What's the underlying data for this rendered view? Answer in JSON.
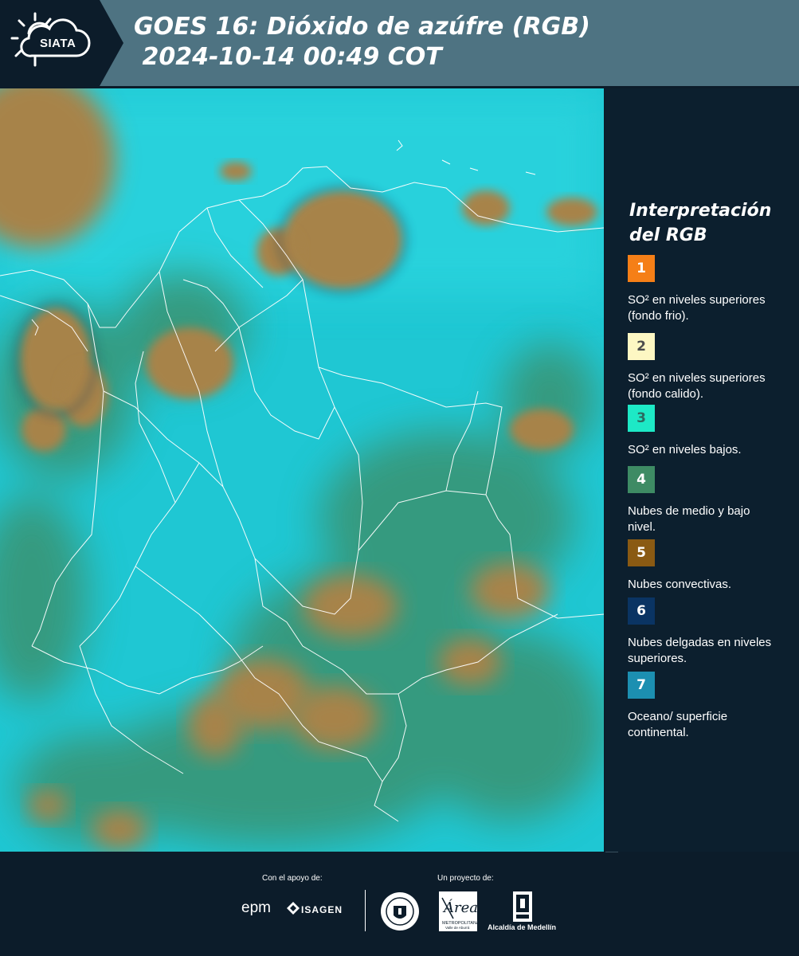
{
  "header": {
    "logo_text": "SIATA",
    "title_line1": "GOES 16: Dióxido de azúfre (RGB)",
    "title_line2": " 2024-10-14 00:49 COT",
    "background_color": "#4e7382"
  },
  "legend": {
    "title_line1": "Interpretación",
    "title_line2": "del RGB",
    "items": [
      {
        "number": "1",
        "color": "#f57f17",
        "text_color": "#ffffff",
        "description": "SO² en niveles superiores (fondo frio)."
      },
      {
        "number": "2",
        "color": "#fdf7c3",
        "text_color": "#4d4d4d",
        "description": "SO² en niveles superiores (fondo calido)."
      },
      {
        "number": "3",
        "color": "#1de9c6",
        "text_color": "#2c6a60",
        "description": "SO² en niveles bajos."
      },
      {
        "number": "4",
        "color": "#3e8b64",
        "text_color": "#ffffff",
        "description": "Nubes de medio y bajo nivel."
      },
      {
        "number": "5",
        "color": "#8a5a13",
        "text_color": "#ffffff",
        "description": "Nubes convectivas."
      },
      {
        "number": "6",
        "color": "#0a3463",
        "text_color": "#ffffff",
        "description": "Nubes delgadas en niveles superiores."
      },
      {
        "number": "7",
        "color": "#1c8fb1",
        "text_color": "#ffffff",
        "description": "Oceano/ superficie continental."
      }
    ]
  },
  "map": {
    "ocean_color": "#1fc7d3",
    "cloud_convective_color": "#a7834a",
    "cloud_low_color": "#3e8b64",
    "border_color": "#ffffff"
  },
  "footer": {
    "support_label": "Con el apoyo de:",
    "project_label": "Un proyecto de:",
    "sponsor1": "epm",
    "sponsor2": "ISAGEN",
    "partner1": "Área Metropolitana Valle de Aburrá",
    "partner2": "Alcaldía de Medellín"
  }
}
